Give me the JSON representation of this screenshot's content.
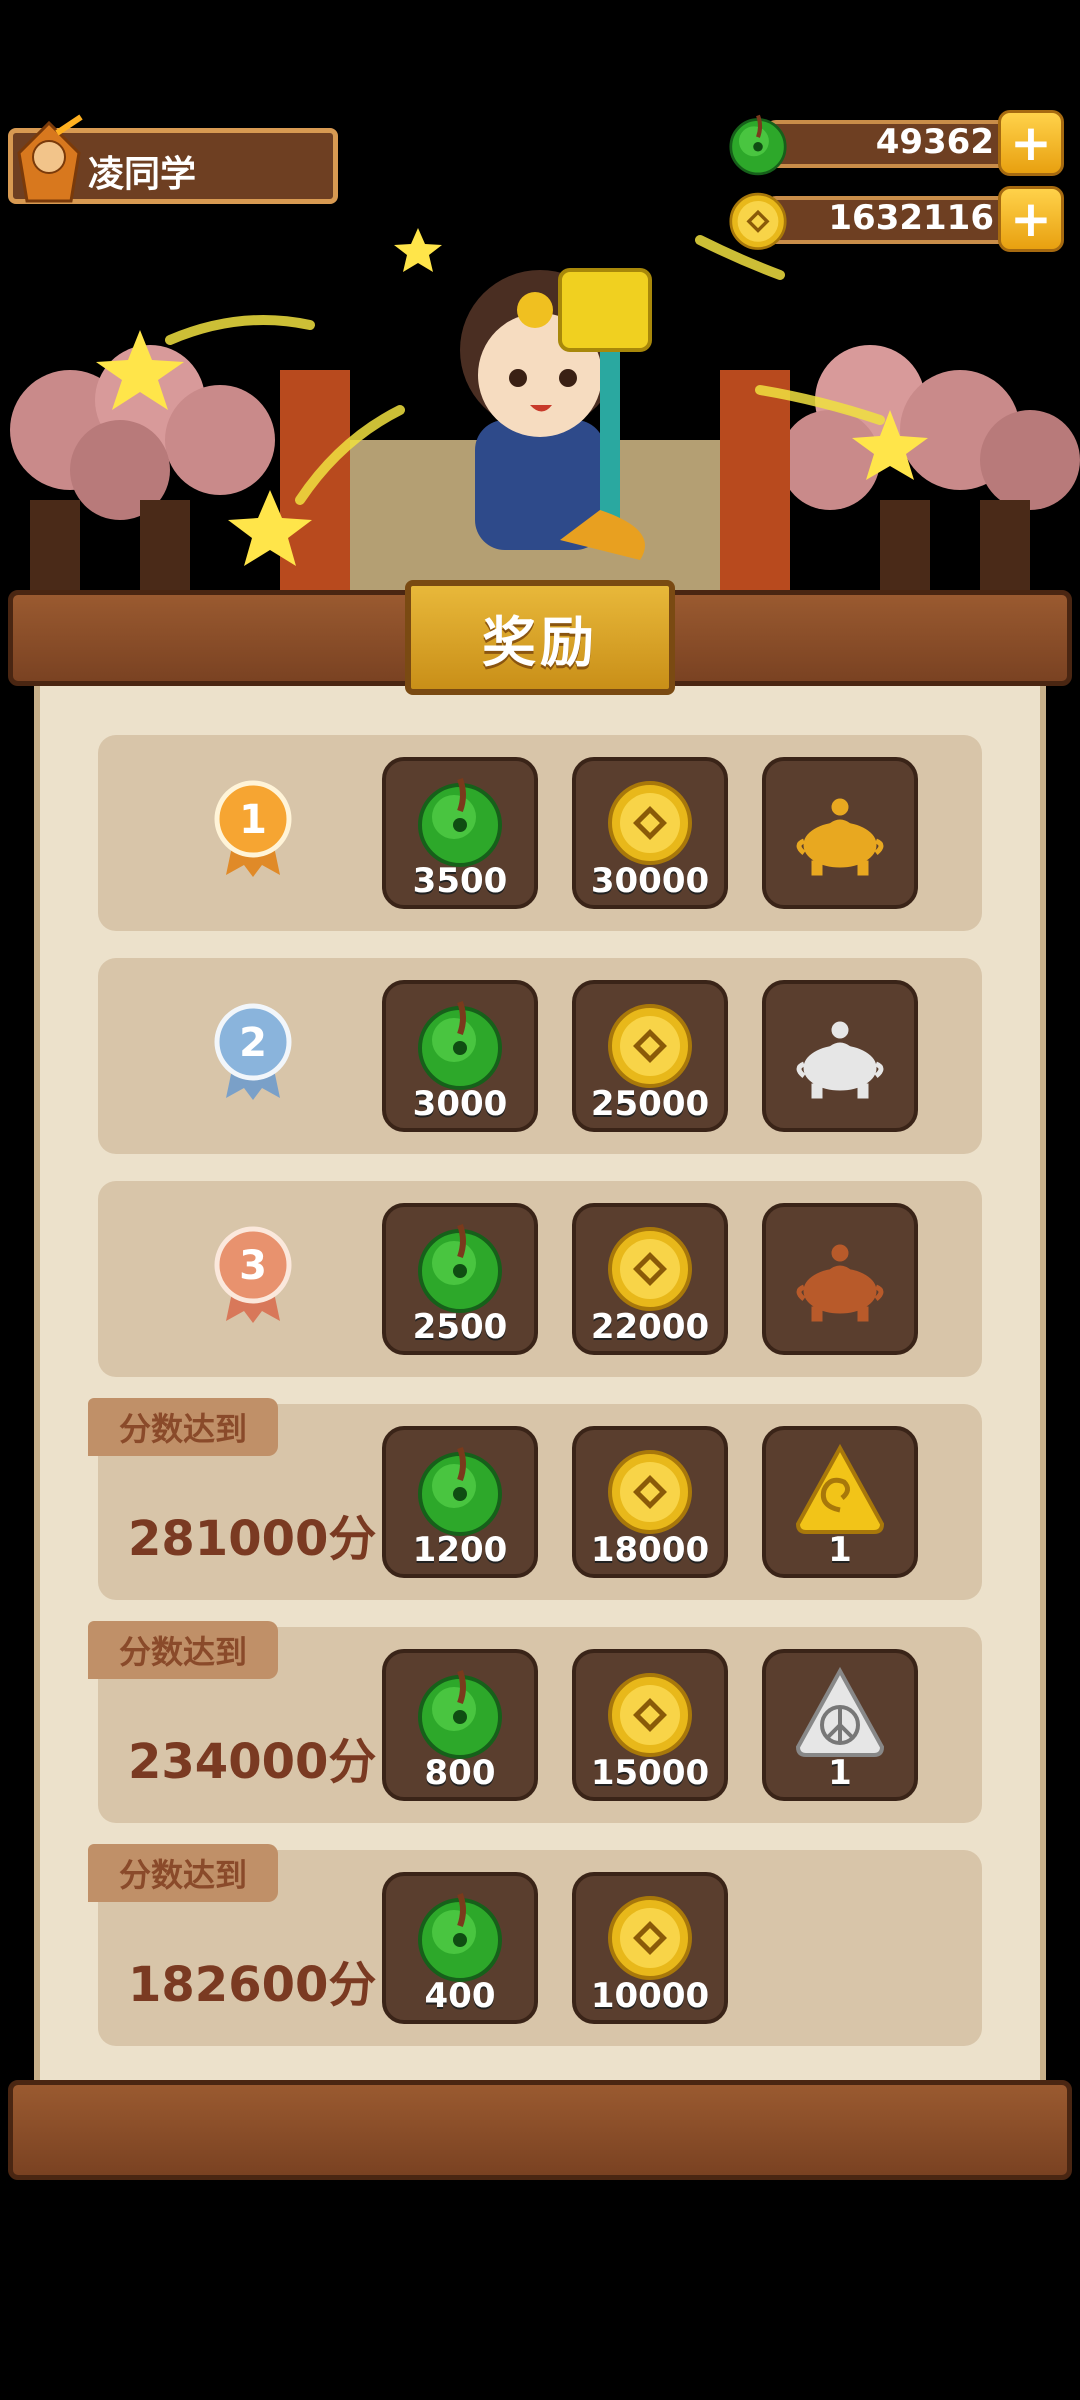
{
  "player": {
    "name": "凌同学"
  },
  "resources": {
    "jade": "49362",
    "coins": "1632116"
  },
  "panel": {
    "title": "奖励"
  },
  "rank_rewards": [
    {
      "rank": "1",
      "jade": "3500",
      "coins": "30000",
      "item": "gold-incense-burner"
    },
    {
      "rank": "2",
      "jade": "3000",
      "coins": "25000",
      "item": "silver-incense-burner"
    },
    {
      "rank": "3",
      "jade": "2500",
      "coins": "22000",
      "item": "bronze-incense-burner"
    }
  ],
  "score_rewards": [
    {
      "label": "分数达到",
      "score": "281000分",
      "jade": "1200",
      "coins": "18000",
      "item_count": "1",
      "item": "spiral-token"
    },
    {
      "label": "分数达到",
      "score": "234000分",
      "jade": "800",
      "coins": "15000",
      "item_count": "1",
      "item": "peace-token"
    },
    {
      "label": "分数达到",
      "score": "182600分",
      "jade": "400",
      "coins": "10000"
    }
  ],
  "colors": {
    "board": "#7a4222",
    "paper": "#ece1cb",
    "row": "#d8c5a9",
    "slot": "#5a3e2e",
    "accent": "#e8b83a"
  }
}
